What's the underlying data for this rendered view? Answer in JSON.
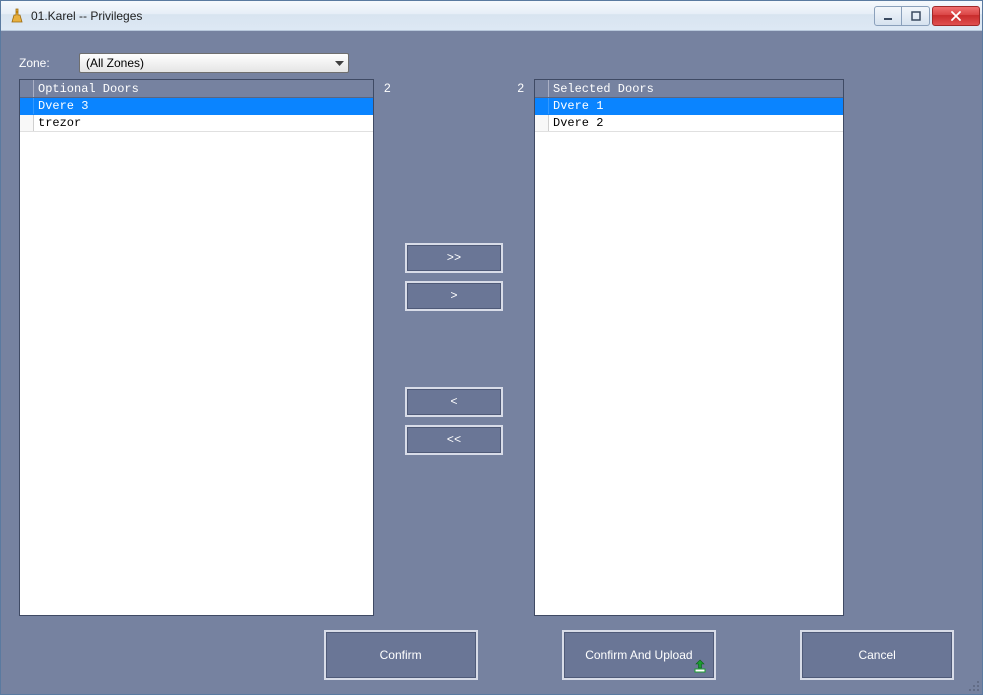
{
  "window": {
    "title": "01.Karel -- Privileges"
  },
  "zone": {
    "label": "Zone:",
    "selected": "(All Zones)"
  },
  "optional": {
    "header": "Optional Doors",
    "count": "2",
    "items": [
      {
        "label": "Dvere 3",
        "selected": true
      },
      {
        "label": "trezor",
        "selected": false
      }
    ]
  },
  "selected": {
    "header": "Selected Doors",
    "count": "2",
    "items": [
      {
        "label": "Dvere 1",
        "selected": true
      },
      {
        "label": "Dvere 2",
        "selected": false
      }
    ]
  },
  "buttons": {
    "move_all_right": ">>",
    "move_right": ">",
    "move_left": "<",
    "move_all_left": "<<",
    "confirm": "Confirm",
    "confirm_upload": "Confirm And Upload",
    "cancel": "Cancel"
  }
}
